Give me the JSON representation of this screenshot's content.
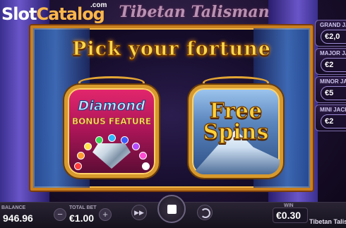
{
  "logo": {
    "part1": "Slot",
    "part2": "Catalog",
    "suffix": ".com"
  },
  "background_title": "Tibetan Talisman",
  "jackpots": [
    {
      "label": "GRAND JA",
      "value": "€2,0"
    },
    {
      "label": "MAJOR JA",
      "value": "€2"
    },
    {
      "label": "MINOR JA",
      "value": "€5"
    },
    {
      "label": "MINI JACK",
      "value": "€2"
    }
  ],
  "modal": {
    "headline": "Pick your fortune",
    "options": {
      "bonus": {
        "title": "Diamond",
        "subtitle": "BONUS FEATURE"
      },
      "free_spins": {
        "line1": "Free",
        "line2": "Spins"
      }
    }
  },
  "gem_colors": [
    "#ff3b3b",
    "#ff9a2e",
    "#ffe24a",
    "#3bd35a",
    "#2fb8ff",
    "#3b5bff",
    "#b44bff",
    "#ff4bd0",
    "#ffffff"
  ],
  "bottom_bar": {
    "balance_label": "BALANCE",
    "balance_value": "946.96",
    "total_bet_label": "TOTAL BET",
    "total_bet_value": "€1.00",
    "minus_label": "−",
    "plus_label": "+",
    "fast_play_label": "▶▶",
    "win_label": "WIN",
    "win_value": "€0.30",
    "game_name": "Tibetan Talism"
  }
}
